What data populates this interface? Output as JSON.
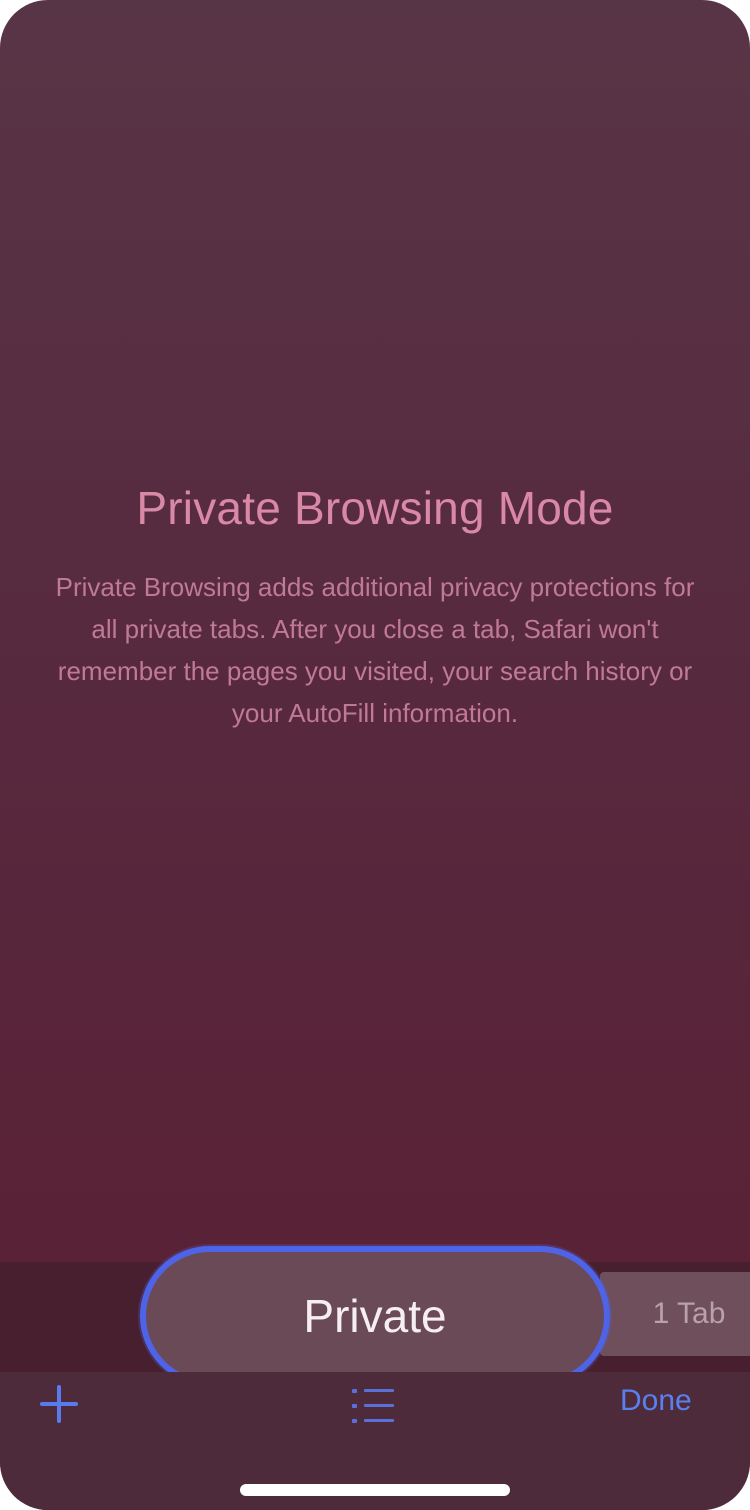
{
  "screen": {
    "title": "Private Browsing Mode",
    "description": "Private Browsing adds additional privacy protections for all private tabs. After you close a tab, Safari won't remember the pages you visited, your search history or your AutoFill information."
  },
  "tab_group": {
    "current_label": "Private",
    "tab_count_label": "1 Tab"
  },
  "toolbar": {
    "add_icon": "plus-icon",
    "list_icon": "list-icon",
    "done_label": "Done"
  },
  "colors": {
    "accent": "#5a80f0",
    "title": "#d988a6",
    "background_top": "#583546",
    "background_bottom": "#562238"
  }
}
